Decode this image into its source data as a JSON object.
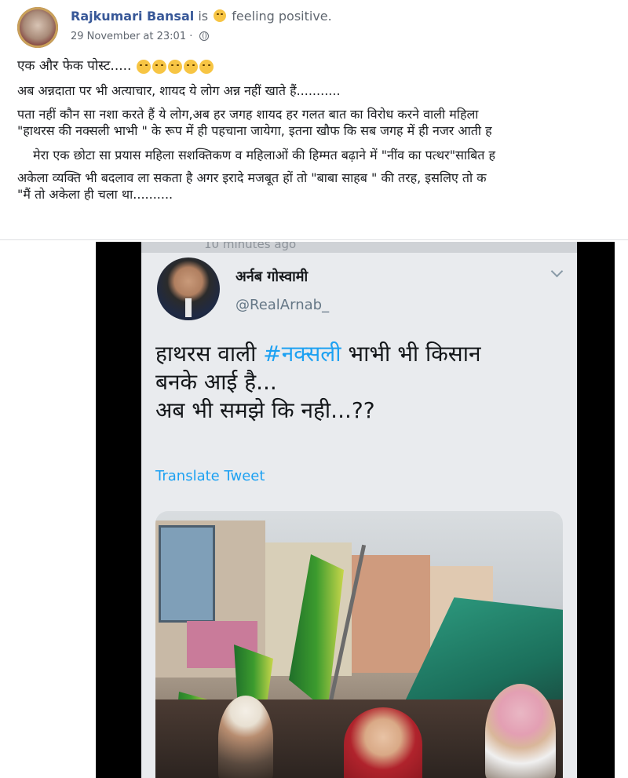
{
  "post": {
    "author": "Rajkumari Bansal",
    "is_word": "is",
    "feeling": "feeling positive.",
    "timestamp": "29 November at 23:01",
    "separator": "·",
    "privacy_icon": "globe-icon",
    "lines": {
      "line1": "एक और फेक पोस्ट.....",
      "line2": "अब अन्नदाता पर भी अत्याचार, शायद ये लोग अन्न नहीं खाते हैं...........",
      "line3": "पता नहीं कौन सा नशा करते हैं ये लोग,अब हर जगह शायद हर गलत बात का विरोध करने वाली महिला",
      "line4": "\"हाथरस की नक्सली भाभी \" के रूप में ही पहचाना जायेगा, इतना खौफ कि सब जगह में ही नजर आती ह",
      "line5": "मेरा एक छोटा सा प्रयास महिला सशक्तिकण व महिलाओं की हिम्मत बढ़ाने में \"नींव का पत्थर\"साबित ह",
      "line6": "अकेला व्यक्ति भी बदलाव ला सकता है अगर इरादे मजबूत हों तो \"बाबा साहब \" की तरह, इसलिए तो क",
      "line7": "\"मैं तो अकेला ही चला था.........."
    }
  },
  "tweet": {
    "status_text": "10 minutes ago",
    "name": "अर्नब गोस्वामी",
    "handle": "@RealArnab_",
    "body_line1_pre": "हाथरस वाली ",
    "body_line1_hashtag": "#नक्सली",
    "body_line1_post": " भाभी भी किसान",
    "body_line2": "बनके आई है...",
    "body_line3": "अब भी समझे कि नही...??",
    "translate_label": "Translate Tweet"
  },
  "colors": {
    "link_blue": "#385898",
    "twitter_blue": "#1da1f2",
    "meta_gray": "#606770"
  }
}
